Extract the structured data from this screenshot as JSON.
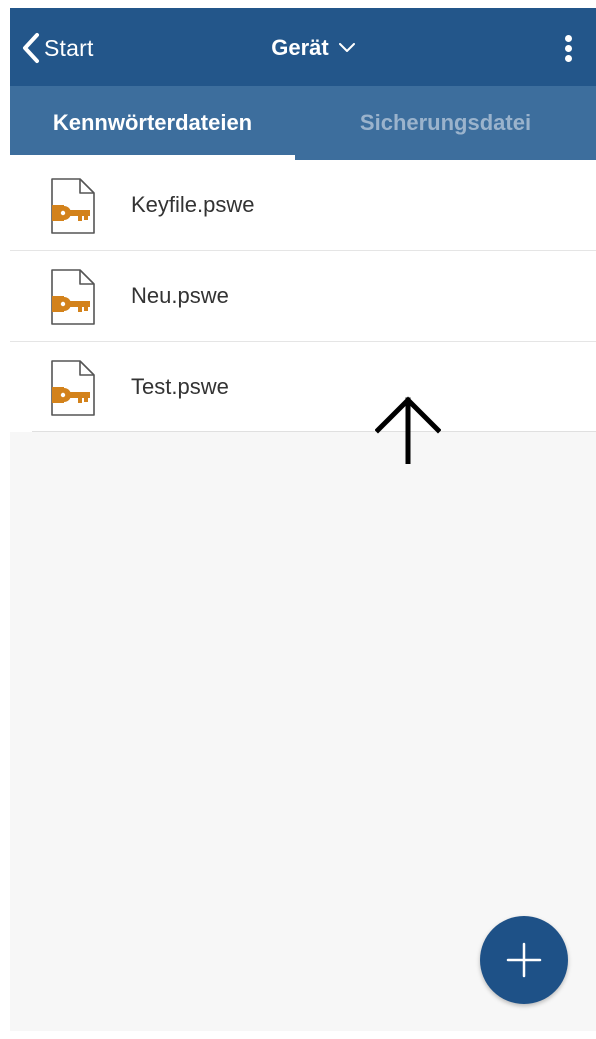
{
  "header": {
    "back_label": "Start",
    "title": "Gerät",
    "title_icon": "chevron-down-icon",
    "menu_icon": "more-vertical-icon"
  },
  "tabs": [
    {
      "label": "Kennwörterdateien",
      "active": true
    },
    {
      "label": "Sicherungsdatei",
      "active": false
    }
  ],
  "files": [
    {
      "name": "Keyfile.pswe",
      "icon": "key-file-icon"
    },
    {
      "name": "Neu.pswe",
      "icon": "key-file-icon"
    },
    {
      "name": "Test.pswe",
      "icon": "key-file-icon"
    }
  ],
  "annotation": {
    "icon": "arrow-up-icon"
  },
  "fab": {
    "icon": "plus-icon"
  },
  "colors": {
    "navbar": "#23568a",
    "tabbar": "#3d6e9d",
    "tab_inactive_text": "#9bb3cc",
    "key_orange": "#d3821b",
    "fab": "#1e5187",
    "background": "#f7f7f7"
  }
}
